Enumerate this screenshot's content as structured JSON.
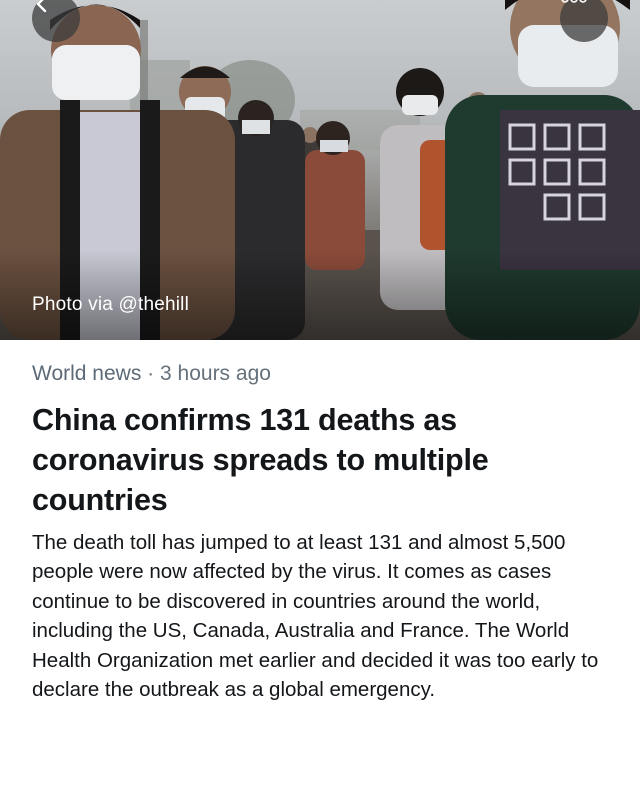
{
  "nav": {
    "back_icon": "chevron-left-icon",
    "more_icon": "ellipsis-icon"
  },
  "hero": {
    "photo_credit": "Photo via @thehill",
    "description_icon": "photo"
  },
  "article": {
    "category": "World news",
    "separator": "·",
    "time": "3 hours ago",
    "headline": "China confirms 131 deaths as coronavirus spreads to multiple countries",
    "body": "The death toll has jumped to at least 131 and almost 5,500 people were now affected by the virus. It comes as cases continue to be discovered in countries around the world, including the US, Canada, Australia and France. The World Health Organization met earlier and decided it was too early to declare the outbreak as a global emergency."
  },
  "colors": {
    "meta_text": "#66717b",
    "headline_text": "#14171a",
    "body_text": "#14171a"
  }
}
